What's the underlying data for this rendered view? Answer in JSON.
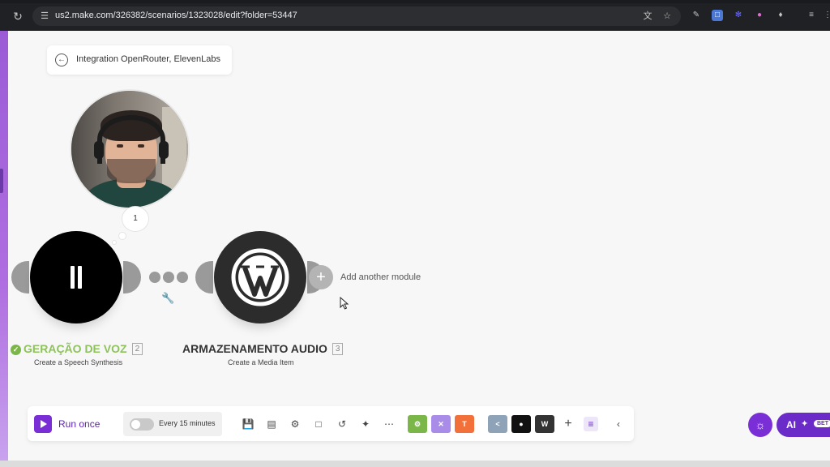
{
  "browser": {
    "url": "us2.make.com/326382/scenarios/1323028/edit?folder=53447"
  },
  "scenario": {
    "title": "Integration OpenRouter, ElevenLabs"
  },
  "canvas": {
    "bubble_count": "1",
    "add_module_label": "Add another module",
    "modules": [
      {
        "title": "GERAÇÃO DE VOZ",
        "number": "2",
        "subtitle": "Create a Speech Synthesis",
        "title_color": "#8ec25a",
        "status": "ok"
      },
      {
        "title": "ARMAZENAMENTO AUDIO",
        "number": "3",
        "subtitle": "Create a Media Item",
        "title_color": "#333333"
      }
    ]
  },
  "toolbar": {
    "run_once_label": "Run once",
    "schedule_label": "Every 15 minutes",
    "icons": [
      "save-icon",
      "scheduling-icon",
      "settings-icon",
      "notes-icon",
      "undo-icon",
      "auto-align-icon",
      "more-icon"
    ],
    "tiles": [
      {
        "name": "tools-tile",
        "color": "#7ab648"
      },
      {
        "name": "flow-control-tile",
        "color": "#a98be8"
      },
      {
        "name": "text-parser-tile",
        "color": "#f2703a",
        "label": "T"
      },
      {
        "name": "elevenlabs-tile",
        "color": "#8fa3b8"
      },
      {
        "name": "openrouter-tile",
        "color": "#111111"
      },
      {
        "name": "wordpress-tile",
        "color": "#333333"
      }
    ]
  },
  "ai_assistant": {
    "label": "AI",
    "badge": "BET"
  },
  "colors": {
    "make_purple": "#7a2fd6",
    "success_green": "#7ab648"
  }
}
